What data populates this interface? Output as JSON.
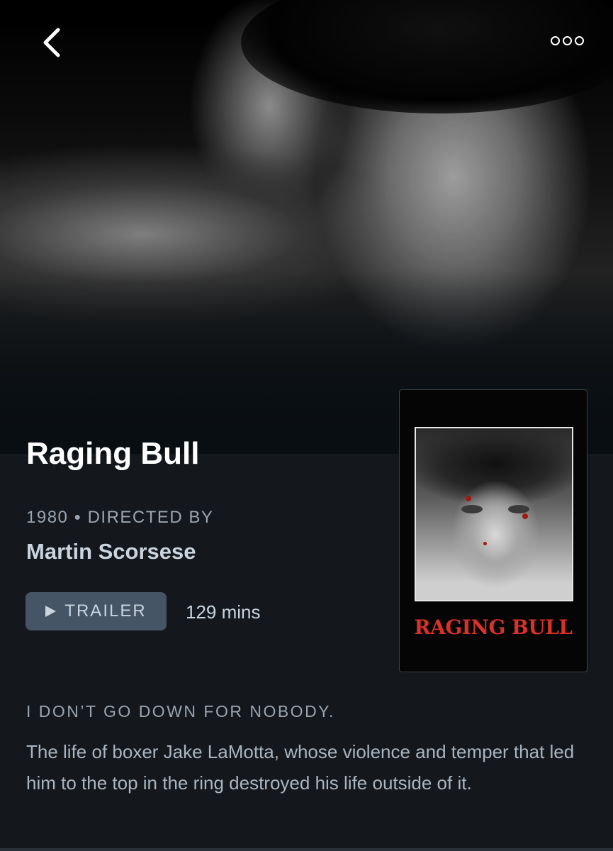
{
  "nav": {
    "back_icon": "chevron-left-icon",
    "more_icon": "more-options-icon"
  },
  "film": {
    "title": "Raging Bull",
    "year": "1980",
    "directed_by_label": "DIRECTED BY",
    "director": "Martin Scorsese",
    "trailer_label": "TRAILER",
    "runtime": "129 mins",
    "tagline": "I DON’T GO DOWN FOR NOBODY.",
    "synopsis": "The life of boxer Jake LaMotta, whose violence and temper that led him to the top in the ring destroyed his life outside of it."
  },
  "poster": {
    "title_text": "RAGING BULL"
  },
  "colors": {
    "background": "#14181c",
    "button_bg": "#455566",
    "text_primary": "#ffffff",
    "text_secondary": "#9aa5b1",
    "poster_title": "#d8322a"
  }
}
